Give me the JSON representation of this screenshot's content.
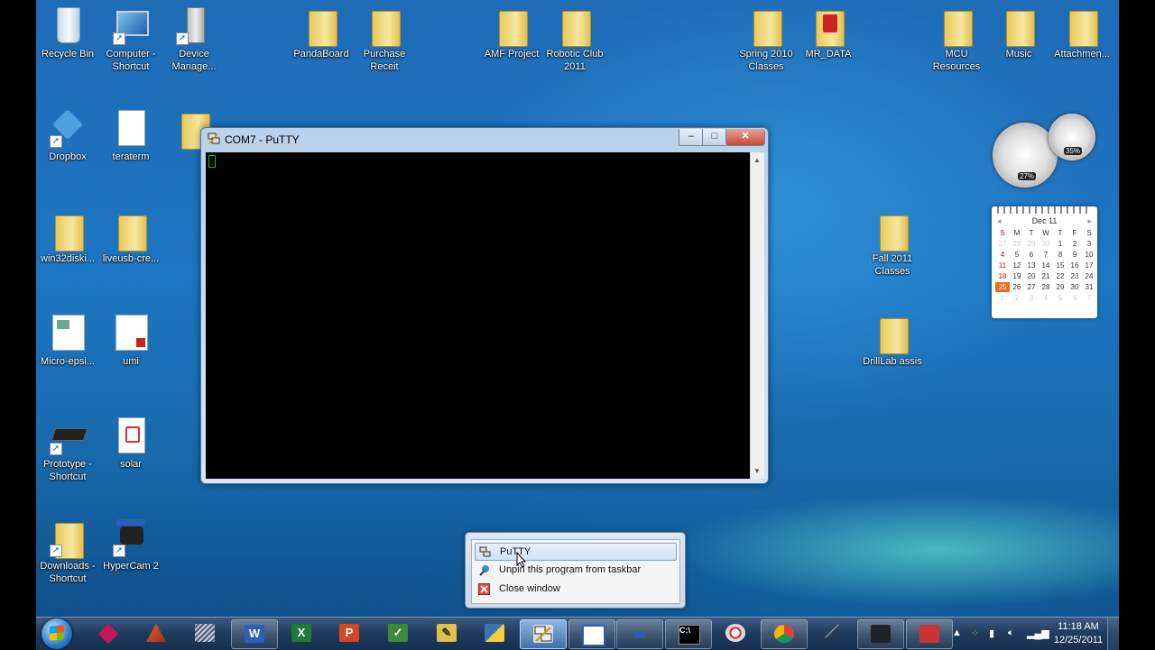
{
  "desktop_icons": [
    {
      "label": "Recycle Bin"
    },
    {
      "label": "Computer -\nShortcut"
    },
    {
      "label": "Device\nManage..."
    },
    {
      "label": "PandaBoard"
    },
    {
      "label": "Purchase\nReceit"
    },
    {
      "label": "AMF Project"
    },
    {
      "label": "Robotic Club\n2011"
    },
    {
      "label": "Spring 2010\nClasses"
    },
    {
      "label": "MR_DATA"
    },
    {
      "label": "MCU\nResources"
    },
    {
      "label": "Music"
    },
    {
      "label": "Attachmen..."
    },
    {
      "label": "Dropbox"
    },
    {
      "label": "teraterm"
    },
    {
      "label": "win32diski..."
    },
    {
      "label": "liveusb-cre..."
    },
    {
      "label": "Micro-epsi..."
    },
    {
      "label": "umi"
    },
    {
      "label": "Prototype -\nShortcut"
    },
    {
      "label": "solar"
    },
    {
      "label": "Downloads -\nShortcut"
    },
    {
      "label": "HyperCam 2"
    },
    {
      "label": "Fall 2011\nClasses"
    },
    {
      "label": "DrillLab assis"
    }
  ],
  "putty_window": {
    "title": "COM7 - PuTTY",
    "minimize": "–",
    "maximize": "□",
    "close": "✕"
  },
  "gadgets": {
    "cpu_percent": "27%",
    "memory_percent": "35%",
    "calendar": {
      "month": "Dec 11",
      "weekdays": [
        "S",
        "M",
        "T",
        "W",
        "T",
        "F",
        "S"
      ],
      "days": [
        "27",
        "28",
        "29",
        "30",
        "1",
        "2",
        "3",
        "4",
        "5",
        "6",
        "7",
        "8",
        "9",
        "10",
        "11",
        "12",
        "13",
        "14",
        "15",
        "16",
        "17",
        "18",
        "19",
        "20",
        "21",
        "22",
        "23",
        "24",
        "25",
        "26",
        "27",
        "28",
        "29",
        "30",
        "31",
        "1",
        "2",
        "3",
        "4",
        "5",
        "6",
        "7"
      ],
      "today": "25"
    }
  },
  "jumplist": {
    "items": [
      {
        "label": "PuTTY",
        "icon": "putty-icon"
      },
      {
        "label": "Unpin this program from taskbar",
        "icon": "unpin-icon"
      },
      {
        "label": "Close window",
        "icon": "close-window-icon"
      }
    ]
  },
  "taskbar": {
    "clock_time": "11:18 AM",
    "clock_date": "12/25/2011",
    "pinned": [
      "app1-icon",
      "matlab-icon",
      "app3-icon",
      "word-icon",
      "excel-icon",
      "powerpoint-icon",
      "project-icon",
      "sketch-icon",
      "python-icon",
      "putty-icon",
      "window-icon",
      "infinity-icon",
      "cmd-icon",
      "paint-icon",
      "chrome-icon",
      "pen-icon",
      "hypercam-icon",
      "toolbox-icon"
    ]
  },
  "colors": {
    "accent": "#1d76c2",
    "today": "#e96b1c"
  }
}
